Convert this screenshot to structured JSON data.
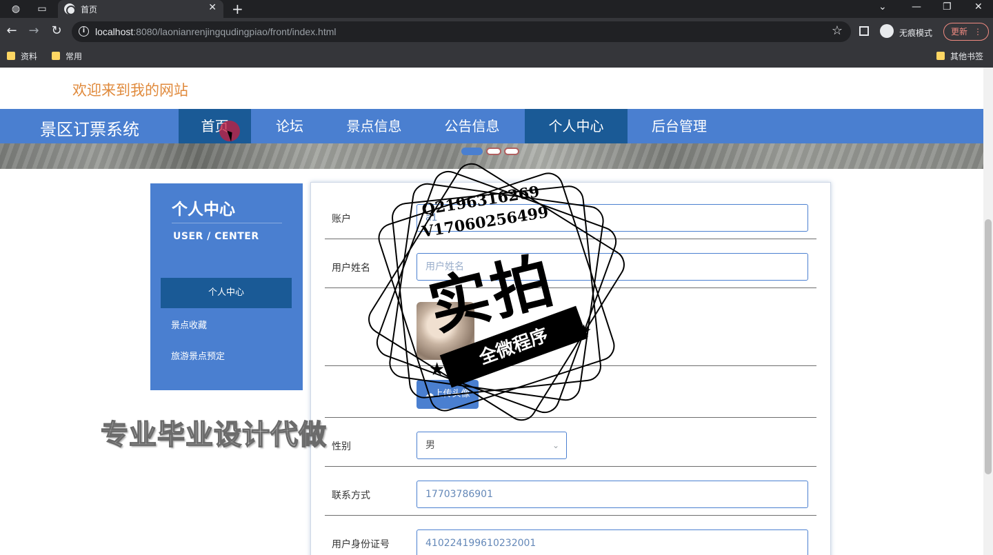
{
  "browser": {
    "tab_title": "首页",
    "url_host": "localhost",
    "url_rest": ":8080/laonianrenjingqudingpiao/front/index.html",
    "incognito_label": "无痕模式",
    "update_label": "更新",
    "bookmarks": [
      "资料",
      "常用"
    ],
    "other_bookmarks": "其他书签"
  },
  "header": {
    "welcome": "欢迎来到我的网站",
    "brand": "景区订票系统",
    "nav": [
      "首页",
      "论坛",
      "景点信息",
      "公告信息",
      "个人中心",
      "后台管理"
    ]
  },
  "sidebar": {
    "title": "个人中心",
    "subtitle": "USER / CENTER",
    "items": [
      "个人中心",
      "景点收藏",
      "旅游景点预定"
    ]
  },
  "form": {
    "account_label": "账户",
    "account_value": "a1",
    "name_label": "用户姓名",
    "name_placeholder": "用户姓名",
    "upload_label": "上传头像",
    "gender_label": "性别",
    "gender_value": "男",
    "phone_label": "联系方式",
    "phone_value": "17703786901",
    "id_label": "用户身份证号",
    "id_value": "410224199610232001"
  },
  "watermark": {
    "line1": "Q2196316269",
    "line2": "V17060256499",
    "big": "实拍",
    "ribbon": "全微程序",
    "bottom": "专业毕业设计代做"
  },
  "colors": {
    "primary": "#4a7fd0",
    "active": "#1a5a96",
    "welcome": "#e08a3c"
  }
}
